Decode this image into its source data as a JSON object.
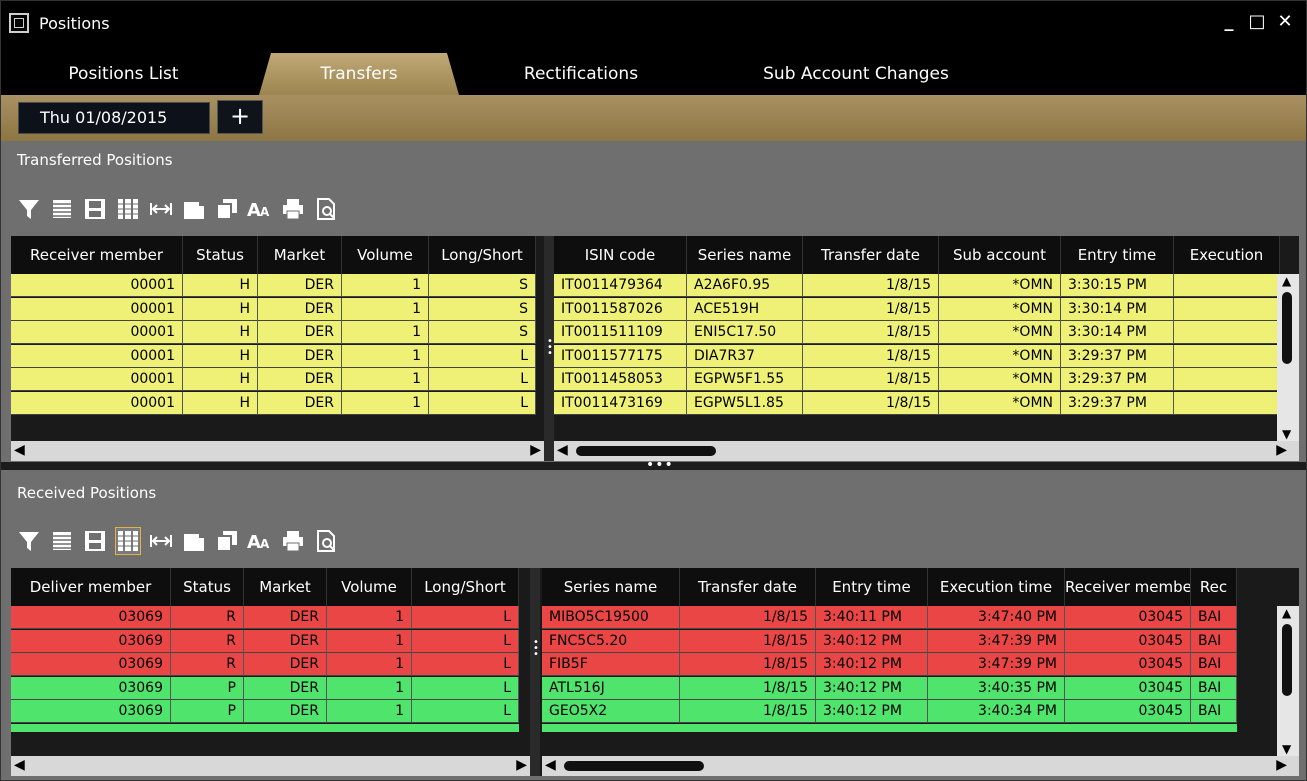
{
  "window": {
    "title": "Positions",
    "minimize": "_",
    "maximize": "□",
    "close": "✕"
  },
  "tabs": [
    {
      "label": "Positions List"
    },
    {
      "label": "Transfers"
    },
    {
      "label": "Rectifications"
    },
    {
      "label": "Sub Account Changes"
    }
  ],
  "datebar": {
    "date": "Thu 01/08/2015",
    "add": "+"
  },
  "transferred": {
    "title": "Transferred Positions",
    "left_headers": [
      "Receiver member",
      "Status",
      "Market",
      "Volume",
      "Long/Short"
    ],
    "right_headers": [
      "ISIN code",
      "Series name",
      "Transfer date",
      "Sub account",
      "Entry time",
      "Execution"
    ],
    "rows": [
      {
        "left": [
          "00001",
          "H",
          "DER",
          "1",
          "S"
        ],
        "right": [
          "IT0011479364",
          "A2A6F0.95",
          "1/8/15",
          "*OMN",
          "3:30:15 PM",
          ""
        ]
      },
      {
        "left": [
          "00001",
          "H",
          "DER",
          "1",
          "S"
        ],
        "right": [
          "IT0011587026",
          "ACE519H",
          "1/8/15",
          "*OMN",
          "3:30:14 PM",
          ""
        ]
      },
      {
        "left": [
          "00001",
          "H",
          "DER",
          "1",
          "S"
        ],
        "right": [
          "IT0011511109",
          "ENI5C17.50",
          "1/8/15",
          "*OMN",
          "3:30:14 PM",
          ""
        ]
      },
      {
        "left": [
          "00001",
          "H",
          "DER",
          "1",
          "L"
        ],
        "right": [
          "IT0011577175",
          "DIA7R37",
          "1/8/15",
          "*OMN",
          "3:29:37 PM",
          ""
        ]
      },
      {
        "left": [
          "00001",
          "H",
          "DER",
          "1",
          "L"
        ],
        "right": [
          "IT0011458053",
          "EGPW5F1.55",
          "1/8/15",
          "*OMN",
          "3:29:37 PM",
          ""
        ]
      },
      {
        "left": [
          "00001",
          "H",
          "DER",
          "1",
          "L"
        ],
        "right": [
          "IT0011473169",
          "EGPW5L1.85",
          "1/8/15",
          "*OMN",
          "3:29:37 PM",
          ""
        ]
      }
    ]
  },
  "received": {
    "title": "Received Positions",
    "left_headers": [
      "Deliver member",
      "Status",
      "Market",
      "Volume",
      "Long/Short"
    ],
    "right_headers": [
      "Series name",
      "Transfer date",
      "Entry time",
      "Execution time",
      "Receiver member",
      "Rec"
    ],
    "rows": [
      {
        "left": [
          "03069",
          "R",
          "DER",
          "1",
          "L"
        ],
        "right": [
          "MIBO5C19500",
          "1/8/15",
          "3:40:11 PM",
          "3:47:40 PM",
          "03045",
          "BAI"
        ]
      },
      {
        "left": [
          "03069",
          "R",
          "DER",
          "1",
          "L"
        ],
        "right": [
          "FNC5C5.20",
          "1/8/15",
          "3:40:12 PM",
          "3:47:39 PM",
          "03045",
          "BAI"
        ]
      },
      {
        "left": [
          "03069",
          "R",
          "DER",
          "1",
          "L"
        ],
        "right": [
          "FIB5F",
          "1/8/15",
          "3:40:12 PM",
          "3:47:39 PM",
          "03045",
          "BAI"
        ]
      },
      {
        "left": [
          "03069",
          "P",
          "DER",
          "1",
          "L"
        ],
        "right": [
          "ATL516J",
          "1/8/15",
          "3:40:12 PM",
          "3:40:35 PM",
          "03045",
          "BAI"
        ]
      },
      {
        "left": [
          "03069",
          "P",
          "DER",
          "1",
          "L"
        ],
        "right": [
          "GEO5X2",
          "1/8/15",
          "3:40:12 PM",
          "3:40:34 PM",
          "03045",
          "BAI"
        ]
      }
    ]
  },
  "toolbar_icons": [
    "filter-icon",
    "list-icon",
    "save-icon",
    "columns-icon",
    "fit-width-icon",
    "copy-icon",
    "duplicate-icon",
    "font-size-icon",
    "print-icon",
    "export-icon"
  ],
  "colors": {
    "yellow_row": "#eef176",
    "red_row": "#ea4646",
    "green_row": "#4fe46b",
    "accent_tab": "#b39a66"
  }
}
